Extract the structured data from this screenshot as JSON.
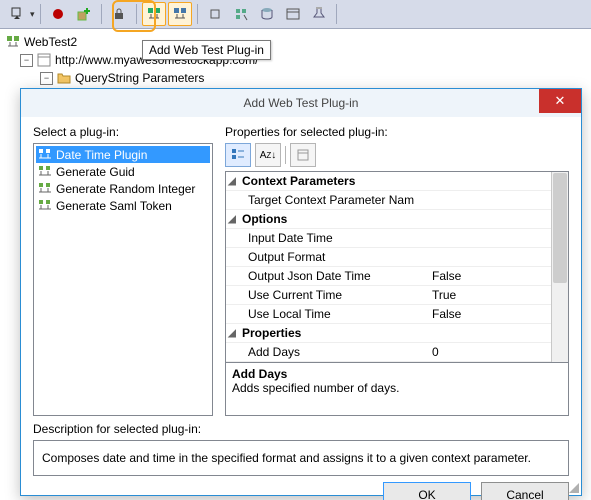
{
  "toolbar": {
    "tooltip": "Add Web Test Plug-in"
  },
  "tree": {
    "root": "WebTest2",
    "url": "http://www.myawesomestockapp.com/",
    "child": "QueryString Parameters"
  },
  "dialog": {
    "title": "Add Web Test Plug-in",
    "select_label": "Select a plug-in:",
    "props_label": "Properties for selected plug-in:",
    "plugins": [
      {
        "label": "Date Time Plugin",
        "selected": true
      },
      {
        "label": "Generate Guid",
        "selected": false
      },
      {
        "label": "Generate Random Integer",
        "selected": false
      },
      {
        "label": "Generate Saml Token",
        "selected": false
      }
    ],
    "propgrid": {
      "categories": [
        {
          "name": "Context Parameters",
          "rows": [
            {
              "name": "Target Context Parameter Nam",
              "value": ""
            }
          ]
        },
        {
          "name": "Options",
          "rows": [
            {
              "name": "Input Date Time",
              "value": ""
            },
            {
              "name": "Output Format",
              "value": ""
            },
            {
              "name": "Output Json Date Time",
              "value": "False"
            },
            {
              "name": "Use Current Time",
              "value": "True"
            },
            {
              "name": "Use Local Time",
              "value": "False"
            }
          ]
        },
        {
          "name": "Properties",
          "rows": [
            {
              "name": "Add Days",
              "value": "0"
            }
          ]
        }
      ],
      "help_title": "Add Days",
      "help_text": "Adds specified number of days."
    },
    "desc_label": "Description for selected plug-in:",
    "desc_text": "Composes date and time in the specified format and assigns it to a given context parameter.",
    "ok": "OK",
    "cancel": "Cancel"
  }
}
